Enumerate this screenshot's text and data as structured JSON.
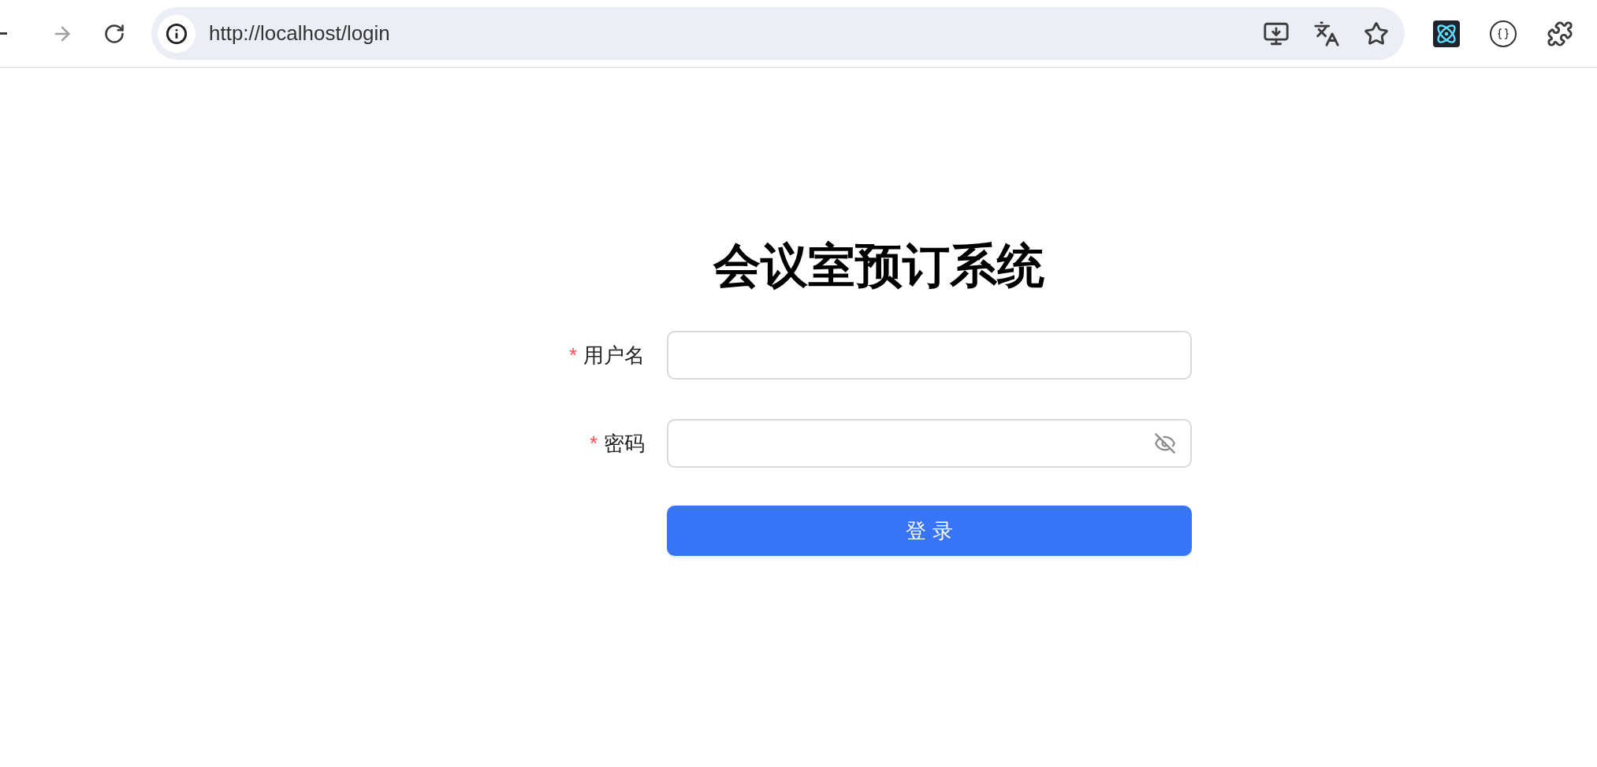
{
  "browser": {
    "nav": [
      {
        "kind": "back",
        "disabled": false
      },
      {
        "kind": "forward",
        "disabled": true
      },
      {
        "kind": "reload",
        "disabled": false
      }
    ],
    "url": "http://localhost/login"
  },
  "form": {
    "title": "会议室预订系统",
    "fields": [
      {
        "label": "用户名",
        "required_mark": "*",
        "kind": "text"
      },
      {
        "label": "密码",
        "required_mark": "*",
        "kind": "password"
      }
    ],
    "submit": "登 录"
  }
}
